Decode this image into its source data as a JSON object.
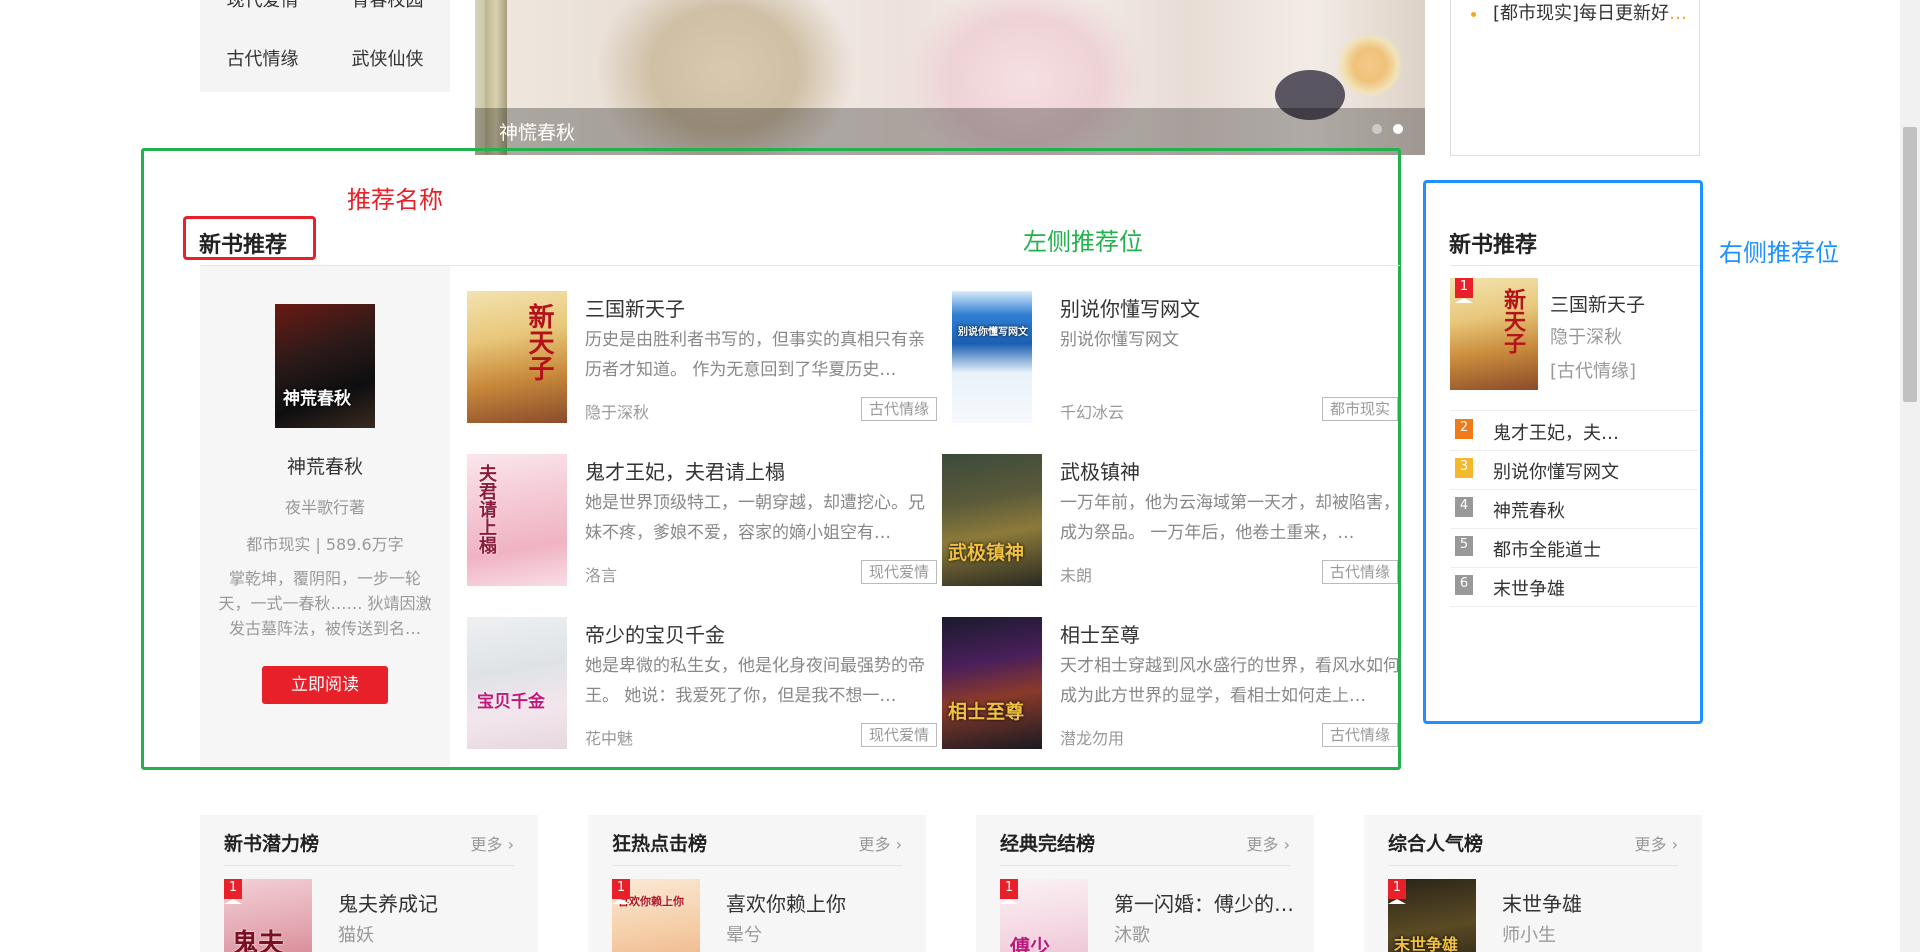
{
  "colors": {
    "accent_red": "#e8202a",
    "annotation_green": "#22b14c",
    "annotation_blue": "#1e90ff",
    "highlight_orange": "#f5a623"
  },
  "categories": {
    "row0": [
      "现代爱情",
      "青春校园"
    ],
    "row1": [
      "古代情缘",
      "武侠仙侠"
    ]
  },
  "banner": {
    "caption": "神慌春秋"
  },
  "right_top": {
    "item": "[都市现实]每日更新好",
    "ellipsis": "…"
  },
  "annotations": {
    "name_label": "推荐名称",
    "left_label": "左侧推荐位",
    "right_label": "右侧推荐位"
  },
  "left_section": {
    "title": "新书推荐",
    "featured": {
      "cover_text": "神荒春秋",
      "name": "神荒春秋",
      "author": "夜半歌行著",
      "meta": "都市现实  |  589.6万字",
      "desc": "掌乾坤，覆阴阳，一步一轮天，一式一春秋…… 狄靖因激发古墓阵法，被传送到名…",
      "button": "立即阅读"
    },
    "books": [
      {
        "cover_text": "新天子",
        "title": "三国新天子",
        "desc": "历史是由胜利者书写的，但事实的真相只有亲历者才知道。 作为无意回到了华夏历史…",
        "author": "隐于深秋",
        "tag": "古代情缘"
      },
      {
        "cover_text": "别说你懂写网文",
        "title": "别说你懂写网文",
        "desc": "别说你懂写网文",
        "author": "千幻冰云",
        "tag": "都市现实"
      },
      {
        "cover_text": "夫君请上榻",
        "title": "鬼才王妃，夫君请上榻",
        "desc": "她是世界顶级特工，一朝穿越，却遭挖心。兄妹不疼，爹娘不爱，容家的嫡小姐空有…",
        "author": "洛言",
        "tag": "现代爱情"
      },
      {
        "cover_text": "武极镇神",
        "title": "武极镇神",
        "desc": "一万年前，他为云海域第一天才，却被陷害，成为祭品。 一万年后，他卷土重来，…",
        "author": "未朗",
        "tag": "古代情缘"
      },
      {
        "cover_text": "宝贝千金",
        "title": "帝少的宝贝千金",
        "desc": "她是卑微的私生女，他是化身夜间最强势的帝王。 她说：我爱死了你，但是我不想一…",
        "author": "花中魅",
        "tag": "现代爱情"
      },
      {
        "cover_text": "相士至尊",
        "title": "相士至尊",
        "desc": "天才相士穿越到风水盛行的世界，看风水如何成为此方世界的显学，看相士如何走上…",
        "author": "潜龙勿用",
        "tag": "古代情缘"
      }
    ]
  },
  "right_section": {
    "title": "新书推荐",
    "top": {
      "rank": "1",
      "cover_text": "新天子",
      "title": "三国新天子",
      "author": "隐于深秋",
      "tag": "[古代情缘]"
    },
    "items": [
      {
        "rank": "2",
        "label": "鬼才王妃，夫…"
      },
      {
        "rank": "3",
        "label": "别说你懂写网文"
      },
      {
        "rank": "4",
        "label": "神荒春秋"
      },
      {
        "rank": "5",
        "label": "都市全能道士"
      },
      {
        "rank": "6",
        "label": "末世争雄"
      }
    ]
  },
  "bottom_panels": [
    {
      "title": "新书潜力榜",
      "more": "更多 ›",
      "rank": "1",
      "cover_text": "鬼夫",
      "book": "鬼夫养成记",
      "author": "猫妖"
    },
    {
      "title": "狂热点击榜",
      "more": "更多 ›",
      "rank": "1",
      "cover_text": "喜欢你赖上你",
      "book": "喜欢你赖上你",
      "author": "晕兮"
    },
    {
      "title": "经典完结榜",
      "more": "更多 ›",
      "rank": "1",
      "cover_text": "傅少",
      "book": "第一闪婚：傅少的…",
      "author": "沐歌"
    },
    {
      "title": "综合人气榜",
      "more": "更多 ›",
      "rank": "1",
      "cover_text": "末世争雄",
      "book": "末世争雄",
      "author": "师小生"
    }
  ]
}
